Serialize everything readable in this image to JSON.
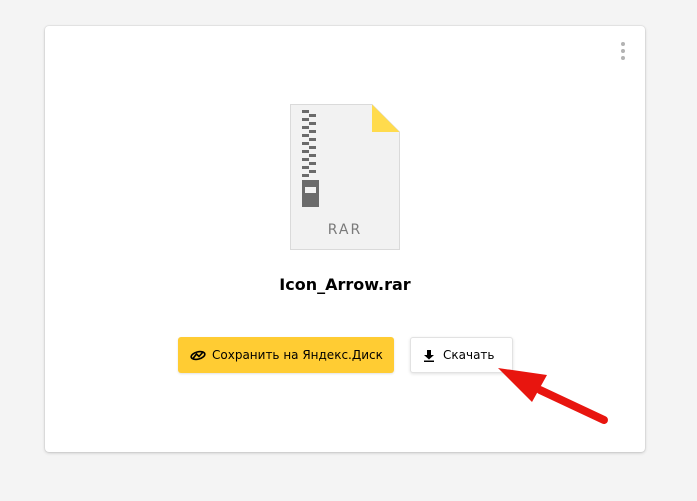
{
  "file": {
    "name": "Icon_Arrow.rar",
    "extension": "RAR",
    "icon": "archive-file-icon",
    "corner_color": "#ffdb4d"
  },
  "actions": {
    "save_label": "Сохранить на Яндекс.Диск",
    "save_icon": "yandex-disk-icon",
    "save_color": "#ffcc33",
    "download_label": "Скачать",
    "download_icon": "download-icon"
  },
  "menu": {
    "icon": "more-vertical-icon"
  },
  "annotation": {
    "icon": "red-arrow-icon",
    "color": "#e8150f"
  }
}
